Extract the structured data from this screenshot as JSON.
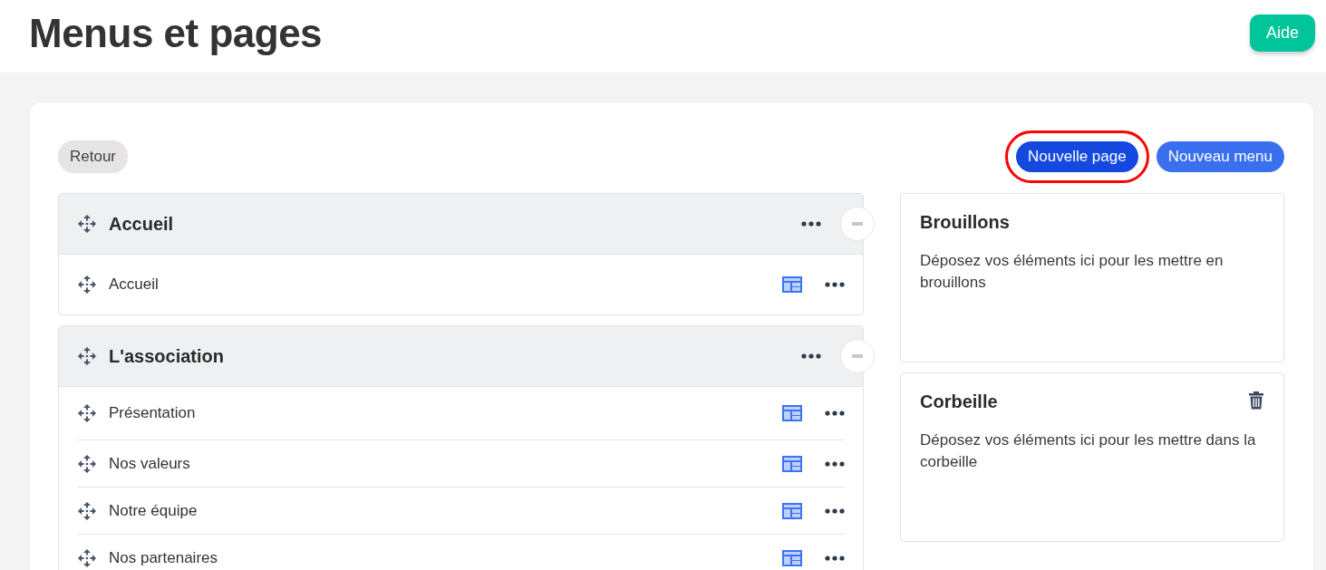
{
  "header": {
    "title": "Menus et pages",
    "help_button": "Aide"
  },
  "toolbar": {
    "back_button": "Retour",
    "buttons": [
      {
        "label": "Nouvelle page",
        "highlighted": true
      },
      {
        "label": "Nouveau menu",
        "highlighted": false
      }
    ]
  },
  "menus": [
    {
      "title": "Accueil",
      "expanded": true,
      "pages": [
        {
          "title": "Accueil"
        }
      ]
    },
    {
      "title": "L'association",
      "expanded": true,
      "pages": [
        {
          "title": "Présentation"
        },
        {
          "title": "Nos valeurs"
        },
        {
          "title": "Notre équipe"
        },
        {
          "title": "Nos partenaires"
        }
      ]
    }
  ],
  "panels": [
    {
      "kind": "drafts",
      "title": "Brouillons",
      "text": "Déposez vos éléments ici pour les mettre en brouillons"
    },
    {
      "kind": "trash",
      "title": "Corbeille",
      "text": "Déposez vos éléments ici pour les mettre dans la corbeille"
    }
  ]
}
